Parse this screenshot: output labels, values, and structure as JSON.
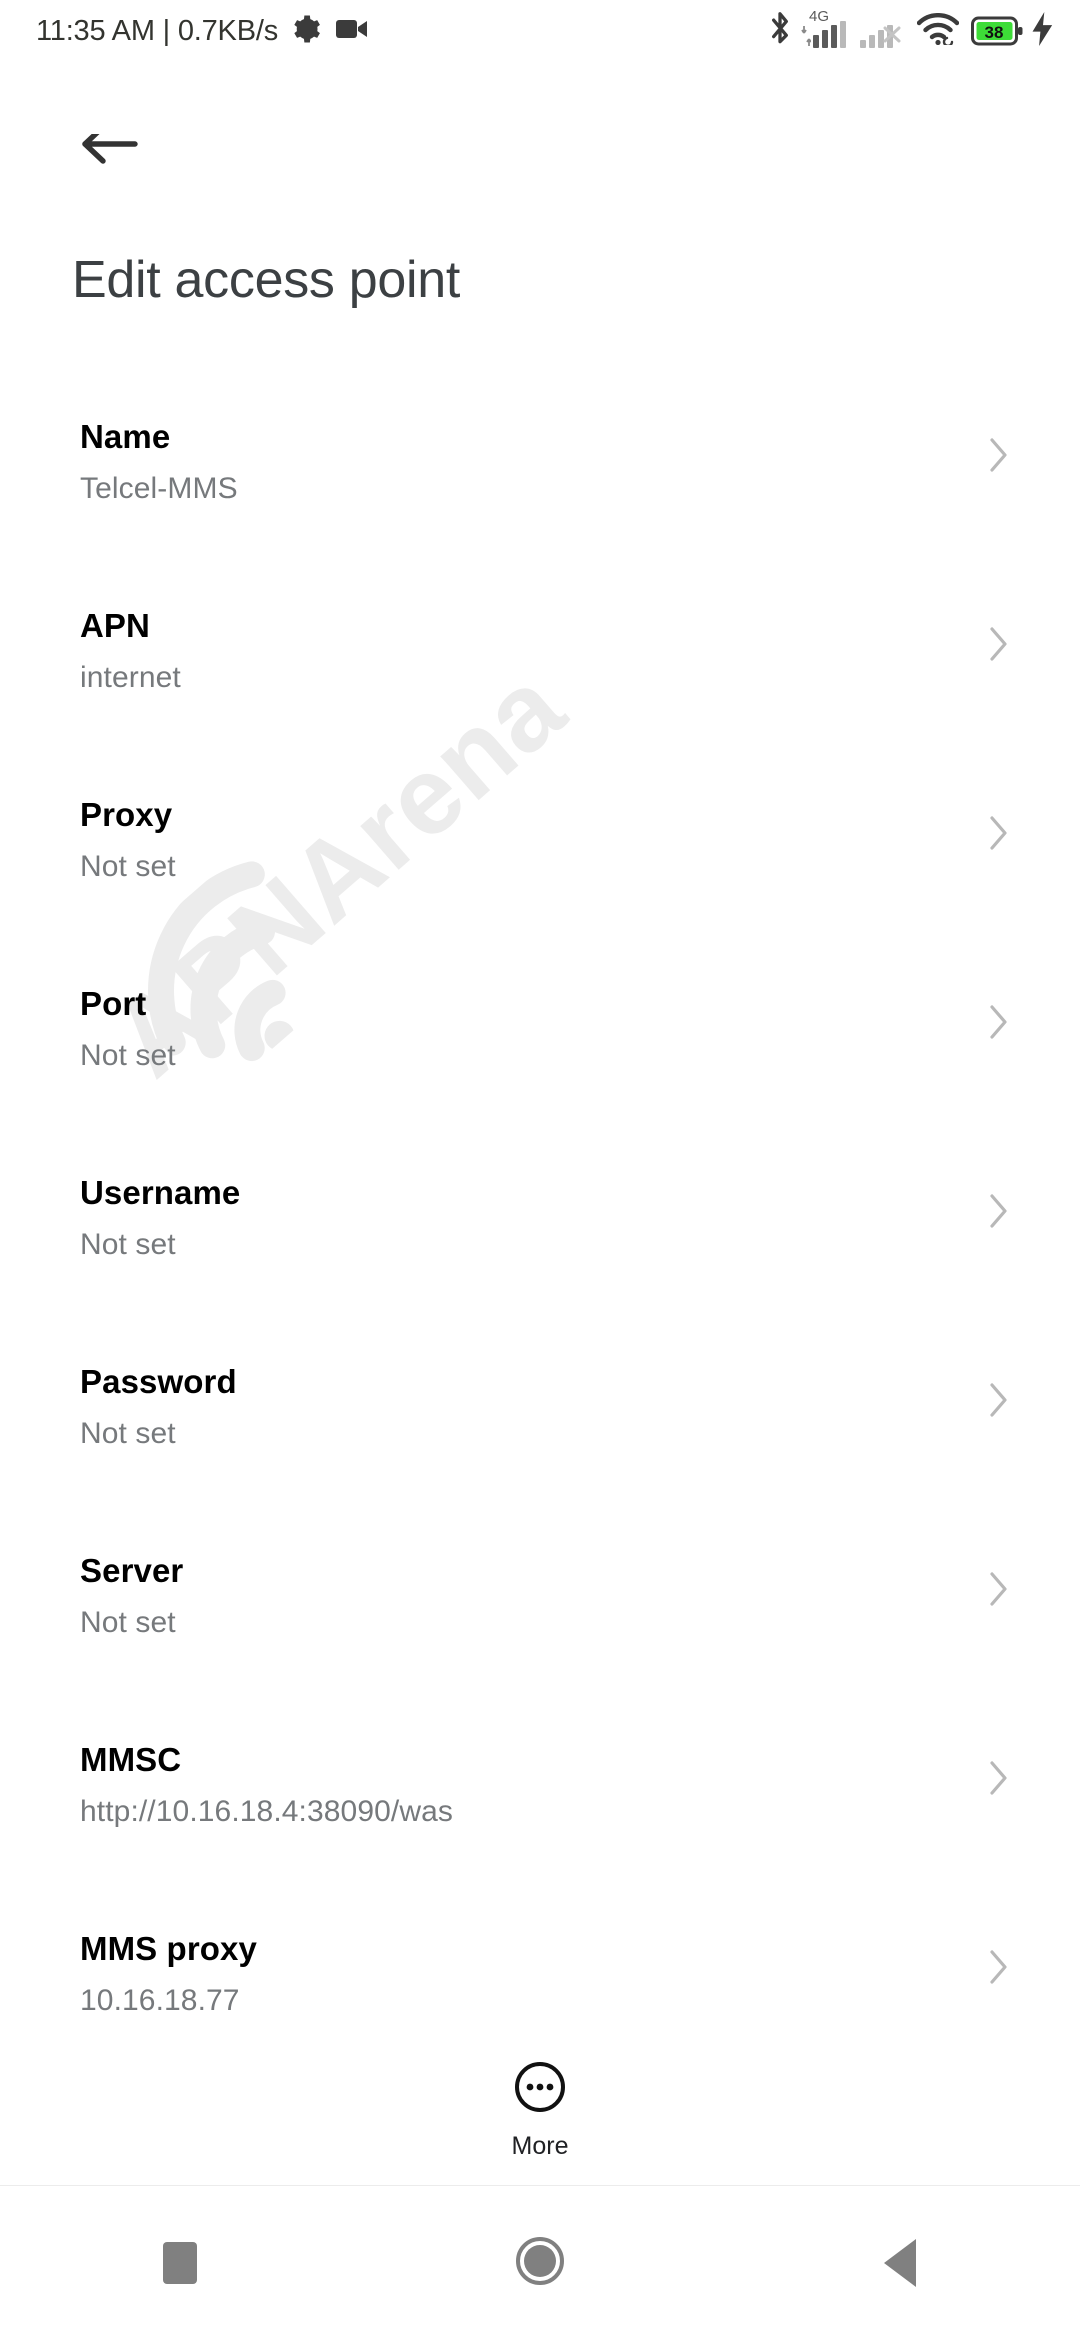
{
  "status_bar": {
    "clock": "11:35 AM",
    "separator": "|",
    "network_speed": "0.7KB/s",
    "gear_icon": "gear-icon",
    "video_icon": "video-camera-icon",
    "bluetooth_icon": "bluetooth-icon",
    "network_type": "4G",
    "signal_icon": "cellular-signal-icon",
    "signal2_icon": "cellular-signal-no-service-icon",
    "wifi_icon": "wifi-icon",
    "battery_level": "38",
    "battery_icon": "battery-icon",
    "charging_icon": "charging-bolt-icon",
    "battery_color": "#3ddc37"
  },
  "app_bar": {
    "back_icon": "back-arrow-icon",
    "title": "Edit access point"
  },
  "watermark": {
    "text": "APNArena"
  },
  "list": {
    "chevron_icon": "chevron-right-icon",
    "rows": [
      {
        "label": "Name",
        "value": "Telcel-MMS"
      },
      {
        "label": "APN",
        "value": "internet"
      },
      {
        "label": "Proxy",
        "value": "Not set"
      },
      {
        "label": "Port",
        "value": "Not set"
      },
      {
        "label": "Username",
        "value": "Not set"
      },
      {
        "label": "Password",
        "value": "Not set"
      },
      {
        "label": "Server",
        "value": "Not set"
      },
      {
        "label": "MMSC",
        "value": "http://10.16.18.4:38090/was"
      },
      {
        "label": "MMS proxy",
        "value": "10.16.18.77"
      }
    ]
  },
  "more_button": {
    "label": "More",
    "icon": "more-ellipsis-circle-icon"
  },
  "nav_bar": {
    "recents_icon": "recents-square-icon",
    "home_icon": "home-circle-icon",
    "back_icon": "back-triangle-icon"
  }
}
